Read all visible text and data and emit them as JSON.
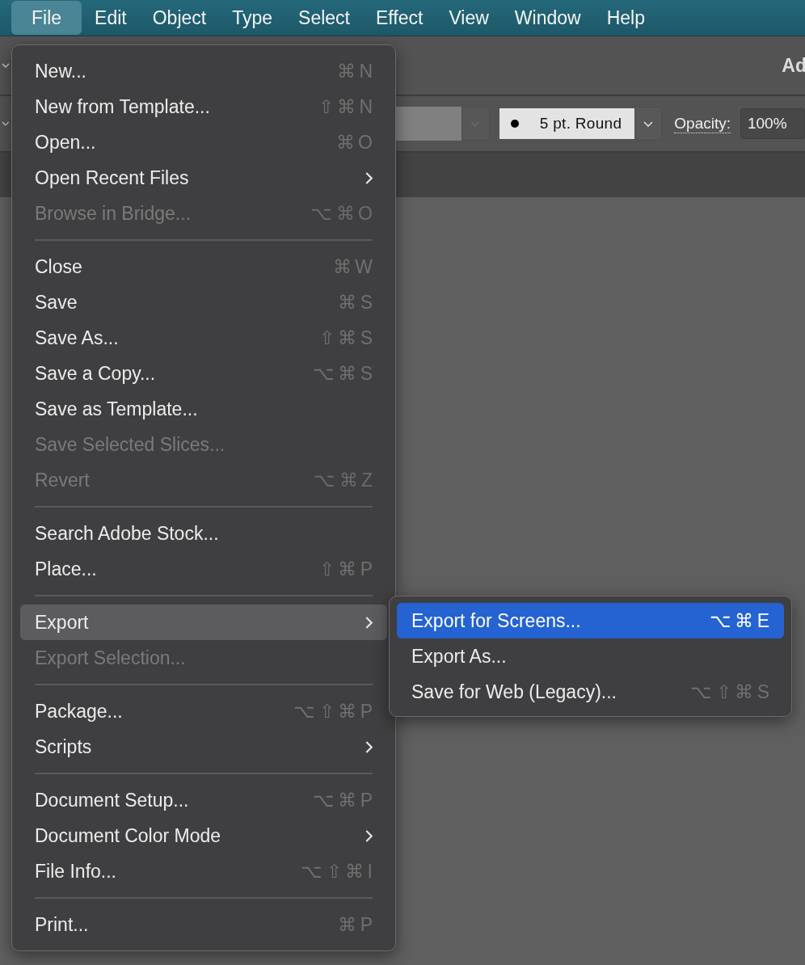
{
  "menubar": [
    {
      "label": "File",
      "selected": true
    },
    {
      "label": "Edit",
      "selected": false
    },
    {
      "label": "Object",
      "selected": false
    },
    {
      "label": "Type",
      "selected": false
    },
    {
      "label": "Select",
      "selected": false
    },
    {
      "label": "Effect",
      "selected": false
    },
    {
      "label": "View",
      "selected": false
    },
    {
      "label": "Window",
      "selected": false
    },
    {
      "label": "Help",
      "selected": false
    }
  ],
  "header": {
    "title_fragment": "Ad"
  },
  "control_bar": {
    "stroke_profile": "5 pt. Round",
    "opacity_label": "Opacity:",
    "opacity_value": "100%"
  },
  "file_menu": [
    {
      "kind": "item",
      "label": "New...",
      "shortcut": "⌘ N",
      "disabled": false,
      "submenu": false,
      "selected": false
    },
    {
      "kind": "item",
      "label": "New from Template...",
      "shortcut": "⇧ ⌘ N",
      "disabled": false,
      "submenu": false,
      "selected": false
    },
    {
      "kind": "item",
      "label": "Open...",
      "shortcut": "⌘ O",
      "disabled": false,
      "submenu": false,
      "selected": false
    },
    {
      "kind": "item",
      "label": "Open Recent Files",
      "disabled": false,
      "submenu": true,
      "selected": false
    },
    {
      "kind": "item",
      "label": "Browse in Bridge...",
      "shortcut": "⌥ ⌘ O",
      "disabled": true,
      "submenu": false,
      "selected": false
    },
    {
      "kind": "separator"
    },
    {
      "kind": "item",
      "label": "Close",
      "shortcut": "⌘ W",
      "disabled": false,
      "submenu": false,
      "selected": false
    },
    {
      "kind": "item",
      "label": "Save",
      "shortcut": "⌘ S",
      "disabled": false,
      "submenu": false,
      "selected": false
    },
    {
      "kind": "item",
      "label": "Save As...",
      "shortcut": "⇧ ⌘ S",
      "disabled": false,
      "submenu": false,
      "selected": false
    },
    {
      "kind": "item",
      "label": "Save a Copy...",
      "shortcut": "⌥ ⌘ S",
      "disabled": false,
      "submenu": false,
      "selected": false
    },
    {
      "kind": "item",
      "label": "Save as Template...",
      "disabled": false,
      "submenu": false,
      "selected": false
    },
    {
      "kind": "item",
      "label": "Save Selected Slices...",
      "disabled": true,
      "submenu": false,
      "selected": false
    },
    {
      "kind": "item",
      "label": "Revert",
      "shortcut": "⌥ ⌘ Z",
      "disabled": true,
      "submenu": false,
      "selected": false
    },
    {
      "kind": "separator"
    },
    {
      "kind": "item",
      "label": "Search Adobe Stock...",
      "disabled": false,
      "submenu": false,
      "selected": false
    },
    {
      "kind": "item",
      "label": "Place...",
      "shortcut": "⇧ ⌘ P",
      "disabled": false,
      "submenu": false,
      "selected": false
    },
    {
      "kind": "separator"
    },
    {
      "kind": "item",
      "label": "Export",
      "disabled": false,
      "submenu": true,
      "selected": true
    },
    {
      "kind": "item",
      "label": "Export Selection...",
      "disabled": true,
      "submenu": false,
      "selected": false
    },
    {
      "kind": "separator"
    },
    {
      "kind": "item",
      "label": "Package...",
      "shortcut": "⌥ ⇧ ⌘ P",
      "disabled": false,
      "submenu": false,
      "selected": false
    },
    {
      "kind": "item",
      "label": "Scripts",
      "disabled": false,
      "submenu": true,
      "selected": false
    },
    {
      "kind": "separator"
    },
    {
      "kind": "item",
      "label": "Document Setup...",
      "shortcut": "⌥ ⌘ P",
      "disabled": false,
      "submenu": false,
      "selected": false
    },
    {
      "kind": "item",
      "label": "Document Color Mode",
      "disabled": false,
      "submenu": true,
      "selected": false
    },
    {
      "kind": "item",
      "label": "File Info...",
      "shortcut": "⌥ ⇧ ⌘ I",
      "disabled": false,
      "submenu": false,
      "selected": false
    },
    {
      "kind": "separator"
    },
    {
      "kind": "item",
      "label": "Print...",
      "shortcut": "⌘ P",
      "disabled": false,
      "submenu": false,
      "selected": false
    }
  ],
  "export_submenu": [
    {
      "label": "Export for Screens...",
      "shortcut": "⌥ ⌘ E",
      "selected": true
    },
    {
      "label": "Export As...",
      "selected": false
    },
    {
      "label": "Save for Web (Legacy)...",
      "shortcut": "⌥ ⇧ ⌘ S",
      "selected": false
    }
  ]
}
